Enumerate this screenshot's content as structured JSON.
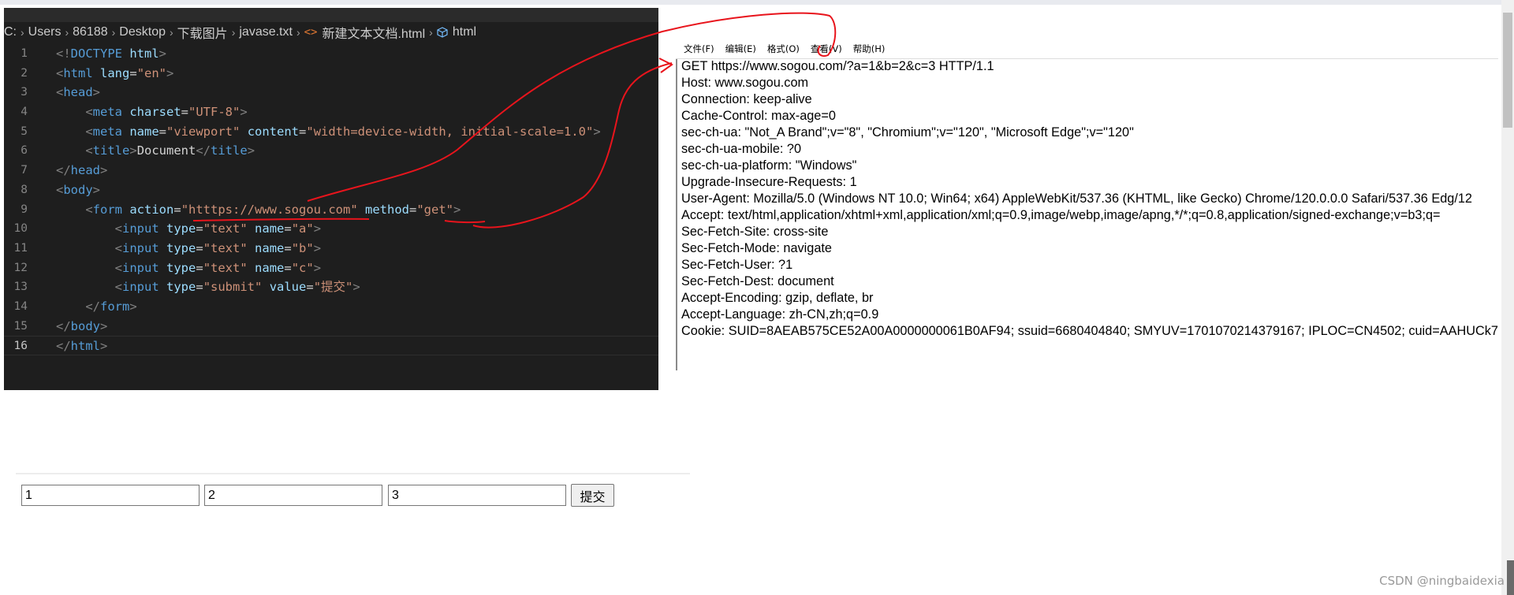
{
  "editor": {
    "breadcrumb": [
      "C:",
      "Users",
      "86188",
      "Desktop",
      "下载图片",
      "javase.txt",
      "新建文本文档.html",
      "html"
    ],
    "lines": [
      {
        "n": "1",
        "tokens": [
          [
            "br",
            "<!"
          ],
          [
            "tag",
            "DOCTYPE"
          ],
          [
            "txt",
            " "
          ],
          [
            "attr",
            "html"
          ],
          [
            "br",
            ">"
          ]
        ]
      },
      {
        "n": "2",
        "tokens": [
          [
            "br",
            "<"
          ],
          [
            "tag",
            "html"
          ],
          [
            "txt",
            " "
          ],
          [
            "attr",
            "lang"
          ],
          [
            "txt",
            "="
          ],
          [
            "str",
            "\"en\""
          ],
          [
            "br",
            ">"
          ]
        ]
      },
      {
        "n": "3",
        "tokens": [
          [
            "br",
            "<"
          ],
          [
            "tag",
            "head"
          ],
          [
            "br",
            ">"
          ]
        ]
      },
      {
        "n": "4",
        "tokens": [
          [
            "txt",
            "    "
          ],
          [
            "br",
            "<"
          ],
          [
            "tag",
            "meta"
          ],
          [
            "txt",
            " "
          ],
          [
            "attr",
            "charset"
          ],
          [
            "txt",
            "="
          ],
          [
            "str",
            "\"UTF-8\""
          ],
          [
            "br",
            ">"
          ]
        ]
      },
      {
        "n": "5",
        "tokens": [
          [
            "txt",
            "    "
          ],
          [
            "br",
            "<"
          ],
          [
            "tag",
            "meta"
          ],
          [
            "txt",
            " "
          ],
          [
            "attr",
            "name"
          ],
          [
            "txt",
            "="
          ],
          [
            "str",
            "\"viewport\""
          ],
          [
            "txt",
            " "
          ],
          [
            "attr",
            "content"
          ],
          [
            "txt",
            "="
          ],
          [
            "str",
            "\"width=device-width, initial-scale=1.0\""
          ],
          [
            "br",
            ">"
          ]
        ]
      },
      {
        "n": "6",
        "tokens": [
          [
            "txt",
            "    "
          ],
          [
            "br",
            "<"
          ],
          [
            "tag",
            "title"
          ],
          [
            "br",
            ">"
          ],
          [
            "txt",
            "Document"
          ],
          [
            "br",
            "</"
          ],
          [
            "tag",
            "title"
          ],
          [
            "br",
            ">"
          ]
        ]
      },
      {
        "n": "7",
        "tokens": [
          [
            "br",
            "</"
          ],
          [
            "tag",
            "head"
          ],
          [
            "br",
            ">"
          ]
        ]
      },
      {
        "n": "8",
        "tokens": [
          [
            "br",
            "<"
          ],
          [
            "tag",
            "body"
          ],
          [
            "br",
            ">"
          ]
        ]
      },
      {
        "n": "9",
        "tokens": [
          [
            "txt",
            "    "
          ],
          [
            "br",
            "<"
          ],
          [
            "tag",
            "form"
          ],
          [
            "txt",
            " "
          ],
          [
            "attr",
            "action"
          ],
          [
            "txt",
            "="
          ],
          [
            "str",
            "\"htttps://www.sogou.com\""
          ],
          [
            "txt",
            " "
          ],
          [
            "attr",
            "method"
          ],
          [
            "txt",
            "="
          ],
          [
            "str",
            "\"get\""
          ],
          [
            "br",
            ">"
          ]
        ]
      },
      {
        "n": "10",
        "tokens": [
          [
            "txt",
            "        "
          ],
          [
            "br",
            "<"
          ],
          [
            "tag",
            "input"
          ],
          [
            "txt",
            " "
          ],
          [
            "attr",
            "type"
          ],
          [
            "txt",
            "="
          ],
          [
            "str",
            "\"text\""
          ],
          [
            "txt",
            " "
          ],
          [
            "attr",
            "name"
          ],
          [
            "txt",
            "="
          ],
          [
            "str",
            "\"a\""
          ],
          [
            "br",
            ">"
          ]
        ]
      },
      {
        "n": "11",
        "tokens": [
          [
            "txt",
            "        "
          ],
          [
            "br",
            "<"
          ],
          [
            "tag",
            "input"
          ],
          [
            "txt",
            " "
          ],
          [
            "attr",
            "type"
          ],
          [
            "txt",
            "="
          ],
          [
            "str",
            "\"text\""
          ],
          [
            "txt",
            " "
          ],
          [
            "attr",
            "name"
          ],
          [
            "txt",
            "="
          ],
          [
            "str",
            "\"b\""
          ],
          [
            "br",
            ">"
          ]
        ]
      },
      {
        "n": "12",
        "tokens": [
          [
            "txt",
            "        "
          ],
          [
            "br",
            "<"
          ],
          [
            "tag",
            "input"
          ],
          [
            "txt",
            " "
          ],
          [
            "attr",
            "type"
          ],
          [
            "txt",
            "="
          ],
          [
            "str",
            "\"text\""
          ],
          [
            "txt",
            " "
          ],
          [
            "attr",
            "name"
          ],
          [
            "txt",
            "="
          ],
          [
            "str",
            "\"c\""
          ],
          [
            "br",
            ">"
          ]
        ]
      },
      {
        "n": "13",
        "tokens": [
          [
            "txt",
            "        "
          ],
          [
            "br",
            "<"
          ],
          [
            "tag",
            "input"
          ],
          [
            "txt",
            " "
          ],
          [
            "attr",
            "type"
          ],
          [
            "txt",
            "="
          ],
          [
            "str",
            "\"submit\""
          ],
          [
            "txt",
            " "
          ],
          [
            "attr",
            "value"
          ],
          [
            "txt",
            "="
          ],
          [
            "str",
            "\"提交\""
          ],
          [
            "br",
            ">"
          ]
        ]
      },
      {
        "n": "14",
        "tokens": [
          [
            "txt",
            "    "
          ],
          [
            "br",
            "</"
          ],
          [
            "tag",
            "form"
          ],
          [
            "br",
            ">"
          ]
        ]
      },
      {
        "n": "15",
        "tokens": [
          [
            "br",
            "</"
          ],
          [
            "tag",
            "body"
          ],
          [
            "br",
            ">"
          ]
        ]
      },
      {
        "n": "16",
        "tokens": [
          [
            "br",
            "</"
          ],
          [
            "tag",
            "html"
          ],
          [
            "br",
            ">"
          ]
        ]
      }
    ]
  },
  "notepad": {
    "menu": [
      "文件(F)",
      "编辑(E)",
      "格式(O)",
      "查看(V)",
      "帮助(H)"
    ],
    "lines": [
      "GET https://www.sogou.com/?a=1&b=2&c=3 HTTP/1.1",
      "Host: www.sogou.com",
      "Connection: keep-alive",
      "Cache-Control: max-age=0",
      "sec-ch-ua: \"Not_A Brand\";v=\"8\", \"Chromium\";v=\"120\", \"Microsoft Edge\";v=\"120\"",
      "sec-ch-ua-mobile: ?0",
      "sec-ch-ua-platform: \"Windows\"",
      "Upgrade-Insecure-Requests: 1",
      "User-Agent: Mozilla/5.0 (Windows NT 10.0; Win64; x64) AppleWebKit/537.36 (KHTML, like Gecko) Chrome/120.0.0.0 Safari/537.36 Edg/12",
      "Accept: text/html,application/xhtml+xml,application/xml;q=0.9,image/webp,image/apng,*/*;q=0.8,application/signed-exchange;v=b3;q=",
      "Sec-Fetch-Site: cross-site",
      "Sec-Fetch-Mode: navigate",
      "Sec-Fetch-User: ?1",
      "Sec-Fetch-Dest: document",
      "Accept-Encoding: gzip, deflate, br",
      "Accept-Language: zh-CN,zh;q=0.9",
      "Cookie: SUID=8AEAB575CE52A00A0000000061B0AF94; ssuid=6680404840; SMYUV=1701070214379167; IPLOC=CN4502; cuid=AAHUCk7"
    ]
  },
  "form": {
    "inputs": [
      "1",
      "2",
      "3"
    ],
    "submit_label": "提交"
  },
  "watermark": "CSDN @ningbaidexia",
  "colors": {
    "editor_bg": "#1e1e1e",
    "tag": "#569cd6",
    "attr": "#9cdcfe",
    "string": "#ce9178",
    "annotation_red": "#e8141c"
  }
}
